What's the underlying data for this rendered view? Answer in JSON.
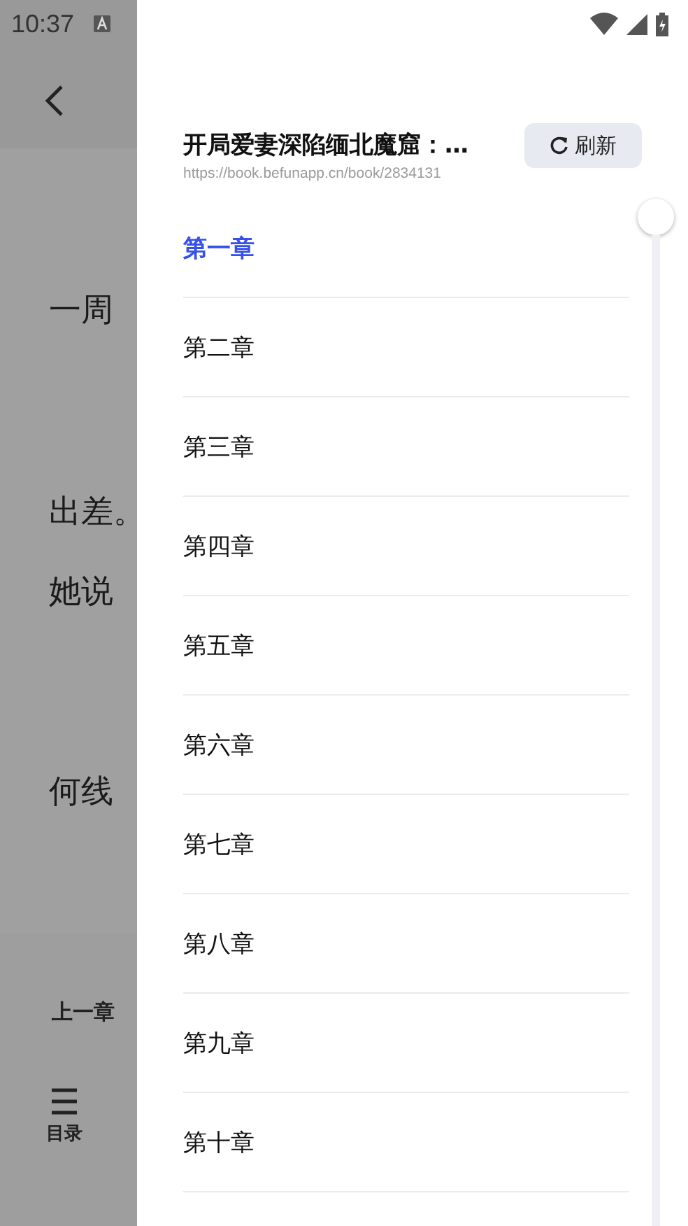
{
  "status_bar": {
    "time": "10:37"
  },
  "reader": {
    "lines": [
      {
        "text": "一周",
        "indent": false
      },
      {
        "text": "出差。",
        "indent": false
      },
      {
        "text": "她说",
        "indent": false
      },
      {
        "text": "何线",
        "indent": false
      }
    ],
    "prev_chapter": "上一章",
    "toc": "目录"
  },
  "drawer": {
    "title": "开局爱妻深陷缅北魔窟：…",
    "url": "https://book.befunapp.cn/book/2834131",
    "refresh": "刷新",
    "chapters": [
      {
        "label": "第一章",
        "selected": true
      },
      {
        "label": "第二章",
        "selected": false
      },
      {
        "label": "第三章",
        "selected": false
      },
      {
        "label": "第四章",
        "selected": false
      },
      {
        "label": "第五章",
        "selected": false
      },
      {
        "label": "第六章",
        "selected": false
      },
      {
        "label": "第七章",
        "selected": false
      },
      {
        "label": "第八章",
        "selected": false
      },
      {
        "label": "第九章",
        "selected": false
      },
      {
        "label": "第十章",
        "selected": false
      }
    ]
  }
}
